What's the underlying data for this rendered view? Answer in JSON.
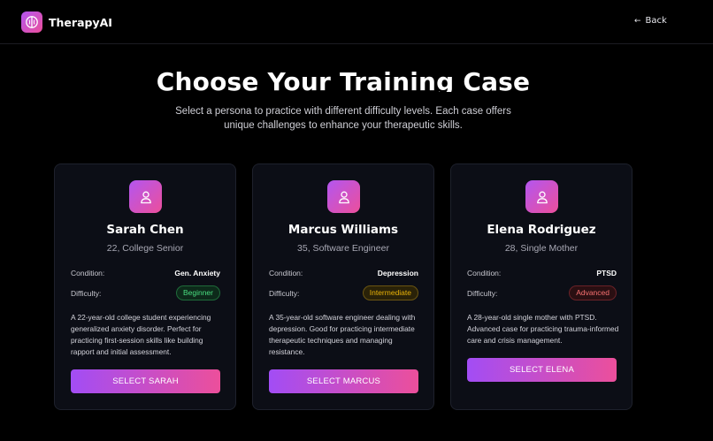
{
  "app": {
    "name": "TherapyAI",
    "logo_icon": "brain-icon"
  },
  "header": {
    "back_label": "Back",
    "back_icon": "arrow-left-icon"
  },
  "hero": {
    "title": "Choose Your Training Case",
    "subtitle": "Select a persona to practice with different difficulty levels. Each case offers unique challenges to enhance your therapeutic skills."
  },
  "labels": {
    "condition": "Condition:",
    "difficulty": "Difficulty:"
  },
  "colors": {
    "accent_start": "#b356f0",
    "accent_end": "#ec4f9b",
    "beginner": "#4ade80",
    "intermediate": "#eab308",
    "advanced": "#f87171"
  },
  "cases": [
    {
      "name": "Sarah Chen",
      "meta": "22, College Senior",
      "condition": "Gen. Anxiety",
      "difficulty": "Beginner",
      "description": "A 22-year-old college student experiencing generalized anxiety disorder. Perfect for practicing first-session skills like building rapport and initial assessment.",
      "button": "SELECT SARAH",
      "avatar_icon": "user-icon"
    },
    {
      "name": "Marcus Williams",
      "meta": "35, Software Engineer",
      "condition": "Depression",
      "difficulty": "Intermediate",
      "description": "A 35-year-old software engineer dealing with depression. Good for practicing intermediate therapeutic techniques and managing resistance.",
      "button": "SELECT MARCUS",
      "avatar_icon": "user-icon"
    },
    {
      "name": "Elena Rodriguez",
      "meta": "28, Single Mother",
      "condition": "PTSD",
      "difficulty": "Advanced",
      "description": "A 28-year-old single mother with PTSD. Advanced case for practicing trauma-informed care and crisis management.",
      "button": "SELECT ELENA",
      "avatar_icon": "user-icon"
    }
  ]
}
